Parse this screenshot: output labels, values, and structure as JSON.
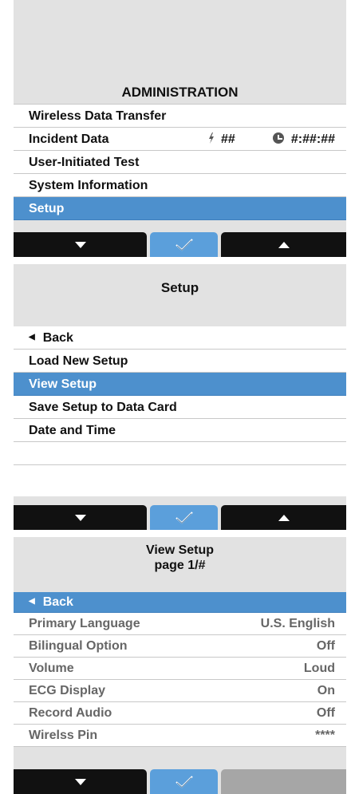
{
  "screen1": {
    "title": "ADMINISTRATION",
    "items": [
      {
        "label": "Wireless Data Transfer"
      },
      {
        "label": "Incident Data",
        "count": "##",
        "time": "#:##:##"
      },
      {
        "label": "User-Initiated Test"
      },
      {
        "label": "System Information"
      },
      {
        "label": "Setup",
        "selected": true
      }
    ]
  },
  "screen2": {
    "title": "Setup",
    "items": [
      {
        "label": "Back",
        "icon": "back-arrow-icon"
      },
      {
        "label": "Load New Setup"
      },
      {
        "label": "View Setup",
        "selected": true
      },
      {
        "label": "Save Setup to Data Card"
      },
      {
        "label": "Date and Time"
      }
    ]
  },
  "screen3": {
    "title": "View Setup",
    "subtitle": "page 1/#",
    "items": [
      {
        "label": "Back",
        "icon": "back-arrow-icon",
        "selected": true
      },
      {
        "label": "Primary Language",
        "value": "U.S. English"
      },
      {
        "label": "Bilingual Option",
        "value": "Off"
      },
      {
        "label": "Volume",
        "value": "Loud"
      },
      {
        "label": "ECG Display",
        "value": "On"
      },
      {
        "label": "Record Audio",
        "value": "Off"
      },
      {
        "label": "Wirelss Pin",
        "value": "****"
      }
    ]
  },
  "buttons": {
    "down": "down-arrow-icon",
    "ok": "checkmark-icon",
    "up": "up-arrow-icon"
  },
  "colors": {
    "selection": "#4d90cd",
    "ok_button": "#5b9fdb",
    "screen_bg": "#e2e2e2",
    "disabled_button": "#a6a6a6"
  }
}
